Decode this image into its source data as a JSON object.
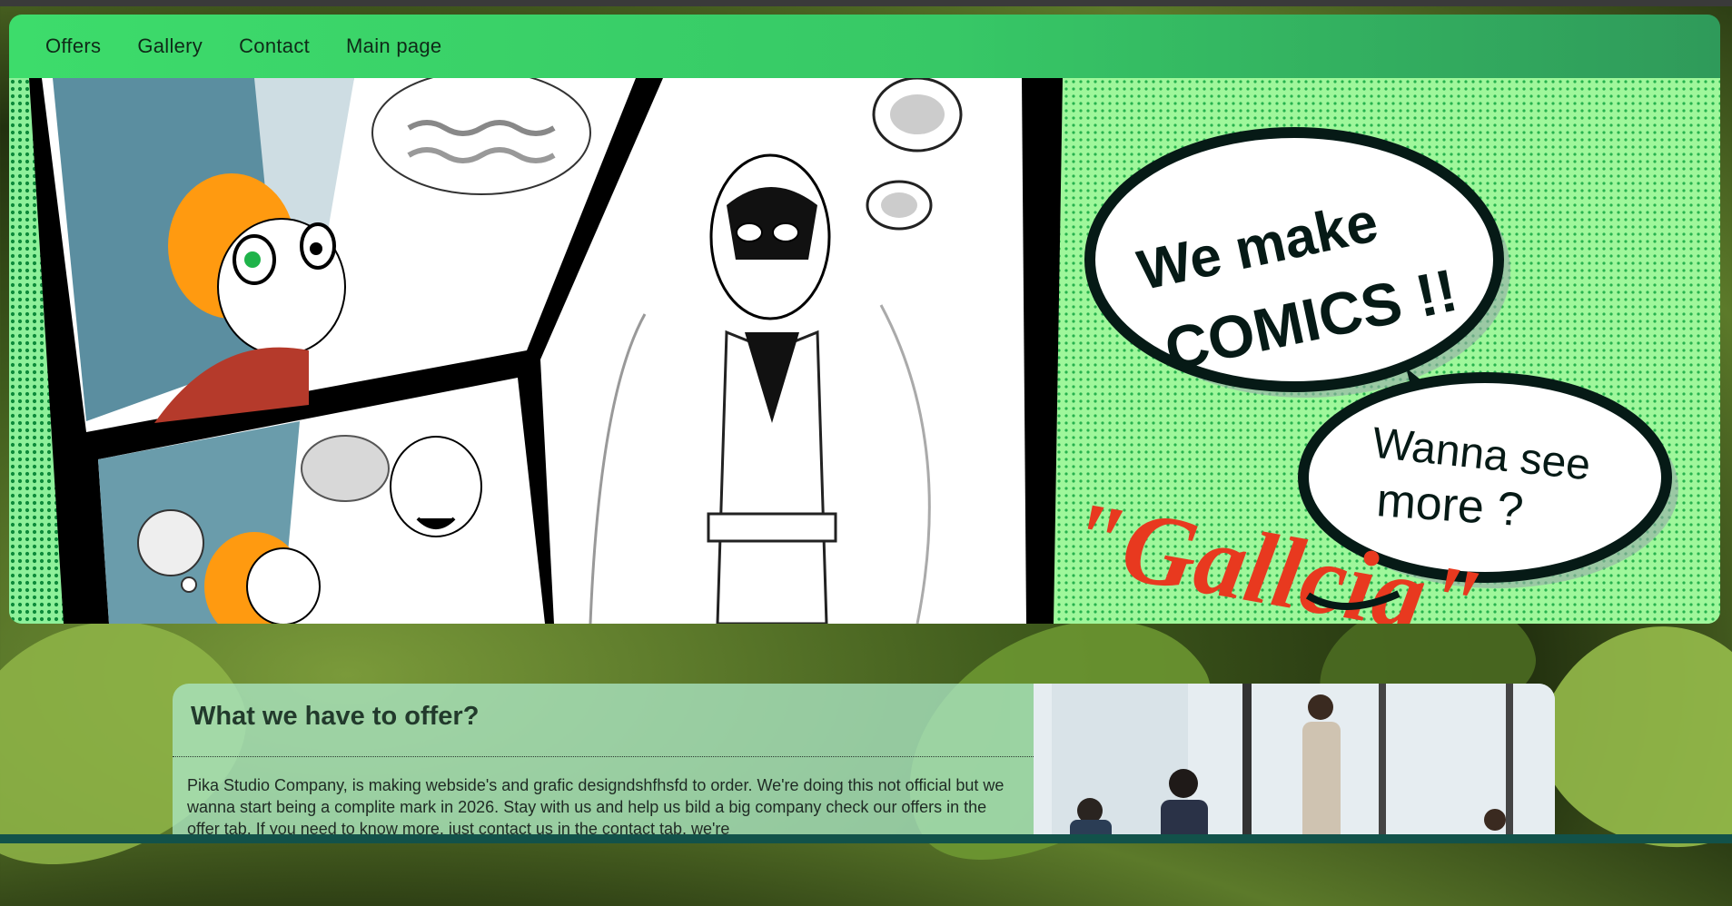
{
  "nav": {
    "items": [
      {
        "label": "Offers"
      },
      {
        "label": "Gallery"
      },
      {
        "label": "Contact"
      },
      {
        "label": "Main page"
      }
    ]
  },
  "hero": {
    "bubble_main": [
      "We make",
      "COMICS !!"
    ],
    "bubble_second": [
      "Wanna see",
      "more ?"
    ],
    "logo_text": "\"Gallcia\""
  },
  "offer": {
    "title": "What we have to offer?",
    "body": "Pika Studio Company, is making webside's and grafic designdshfhsfd to order. We're doing this not official but we wanna start being a complite mark in 2026. Stay with us and help us bild a big company check our offers in the offer tab. If you need to know more, just contact us in the contact tab, we're"
  },
  "colors": {
    "nav_start": "#3ddc6b",
    "nav_end": "#2f9a5a",
    "hero_green": "#2ee36a",
    "text_dark": "#0f2a18",
    "accent_red": "#e8391f",
    "taskbar": "#12524a"
  }
}
